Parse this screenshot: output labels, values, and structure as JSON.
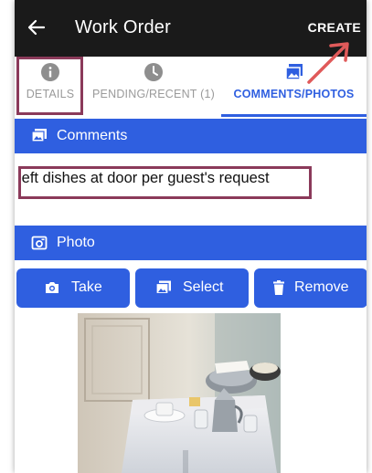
{
  "appbar": {
    "title": "Work Order",
    "create_label": "CREATE"
  },
  "tabs": [
    {
      "label": "DETAILS",
      "icon": "info-icon"
    },
    {
      "label": "PENDING/RECENT (1)",
      "icon": "clock-icon"
    },
    {
      "label": "COMMENTS/PHOTOS",
      "icon": "image-icon",
      "active": true
    }
  ],
  "comments": {
    "header": "Comments",
    "text": "left dishes at door per guest's request"
  },
  "photo": {
    "header": "Photo",
    "buttons": {
      "take": "Take",
      "select": "Select",
      "remove": "Remove"
    }
  },
  "colors": {
    "appbar": "#1a1a1a",
    "accent": "#2f5fe0",
    "highlight": "#8b3a5a",
    "annotation_arrow": "#e05a5a"
  }
}
